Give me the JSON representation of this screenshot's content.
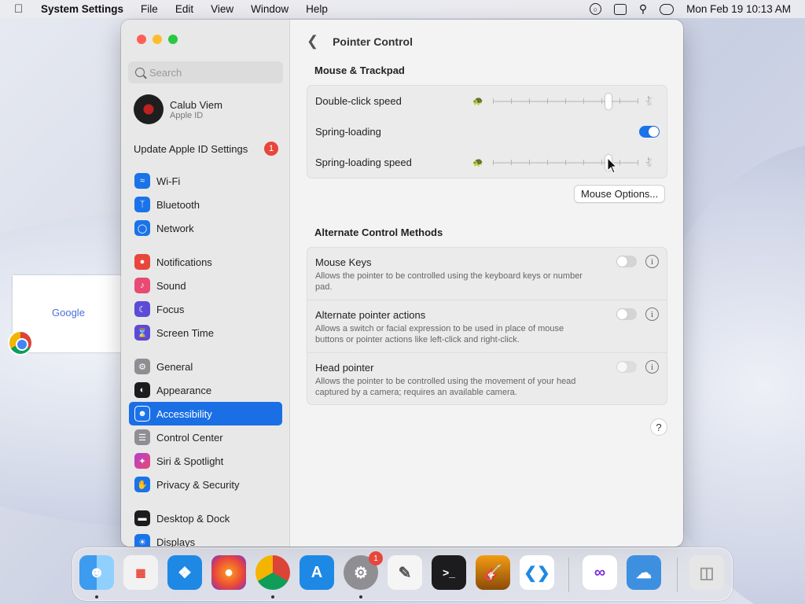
{
  "menubar": {
    "app": "System Settings",
    "menus": [
      "File",
      "Edit",
      "View",
      "Window",
      "Help"
    ],
    "clock": "Mon Feb 19  10:13 AM"
  },
  "desktop": {
    "thumbnail_text": "Google"
  },
  "sidebar": {
    "search_placeholder": "Search",
    "profile_name": "Calub Viem",
    "profile_sub": "Apple ID",
    "update_label": "Update Apple ID Settings",
    "update_badge": "1",
    "items": [
      {
        "label": "Wi-Fi",
        "icon": "wifi-icon",
        "color": "#1a73e8"
      },
      {
        "label": "Bluetooth",
        "icon": "bluetooth-icon",
        "color": "#1a73e8"
      },
      {
        "label": "Network",
        "icon": "globe-icon",
        "color": "#1a73e8"
      },
      {
        "label": "Notifications",
        "icon": "bell-icon",
        "color": "#e8463b"
      },
      {
        "label": "Sound",
        "icon": "speaker-icon",
        "color": "#e84a74"
      },
      {
        "label": "Focus",
        "icon": "moon-icon",
        "color": "#5b4bd6"
      },
      {
        "label": "Screen Time",
        "icon": "hourglass-icon",
        "color": "#5b4bd6"
      },
      {
        "label": "General",
        "icon": "gear-icon",
        "color": "#8e8e93"
      },
      {
        "label": "Appearance",
        "icon": "appearance-icon",
        "color": "#1c1c1e"
      },
      {
        "label": "Accessibility",
        "icon": "accessibility-icon",
        "color": "#1a73e8"
      },
      {
        "label": "Control Center",
        "icon": "control-center-icon",
        "color": "#8e8e93"
      },
      {
        "label": "Siri & Spotlight",
        "icon": "siri-icon",
        "color": "#b23fd1"
      },
      {
        "label": "Privacy & Security",
        "icon": "hand-icon",
        "color": "#1a73e8"
      },
      {
        "label": "Desktop & Dock",
        "icon": "dock-icon",
        "color": "#1c1c1e"
      },
      {
        "label": "Displays",
        "icon": "display-icon",
        "color": "#1a73e8"
      }
    ],
    "active_index": 9
  },
  "content": {
    "title": "Pointer Control",
    "section1": "Mouse & Trackpad",
    "double_click_label": "Double-click speed",
    "double_click_value": 0.8,
    "spring_loading_label": "Spring-loading",
    "spring_loading_on": true,
    "spring_loading_speed_label": "Spring-loading speed",
    "spring_loading_speed_value": 0.8,
    "mouse_options_label": "Mouse Options...",
    "section2": "Alternate Control Methods",
    "methods": [
      {
        "title": "Mouse Keys",
        "desc": "Allows the pointer to be controlled using the keyboard keys or number pad.",
        "on": false
      },
      {
        "title": "Alternate pointer actions",
        "desc": "Allows a switch or facial expression to be used in place of mouse buttons or pointer actions like left-click and right-click.",
        "on": false
      },
      {
        "title": "Head pointer",
        "desc": "Allows the pointer to be controlled using the movement of your head captured by a camera; requires an available camera.",
        "on": false
      }
    ],
    "help_label": "?",
    "info_label": "i"
  },
  "dock": {
    "apps": [
      {
        "name": "finder-icon",
        "color": "#3d9bf0"
      },
      {
        "name": "launchpad-icon",
        "color": "#f2f2f2"
      },
      {
        "name": "safari-icon",
        "color": "#1e88e5"
      },
      {
        "name": "firefox-icon",
        "color": "#7a2fd6"
      },
      {
        "name": "chrome-icon",
        "color": "#ffffff"
      },
      {
        "name": "app-store-icon",
        "color": "#1e88e5"
      },
      {
        "name": "system-settings-icon",
        "color": "#8e8e93"
      },
      {
        "name": "textedit-icon",
        "color": "#f5f5f5"
      },
      {
        "name": "terminal-icon",
        "color": "#1c1c1e"
      },
      {
        "name": "garageband-icon",
        "color": "#f39c12"
      },
      {
        "name": "vscode-icon",
        "color": "#ffffff"
      },
      {
        "name": "visual-studio-icon",
        "color": "#ffffff"
      },
      {
        "name": "weather-icon",
        "color": "#3d8fe0"
      },
      {
        "name": "trash-icon",
        "color": "#e6e6e6"
      }
    ],
    "settings_badge": "1"
  }
}
